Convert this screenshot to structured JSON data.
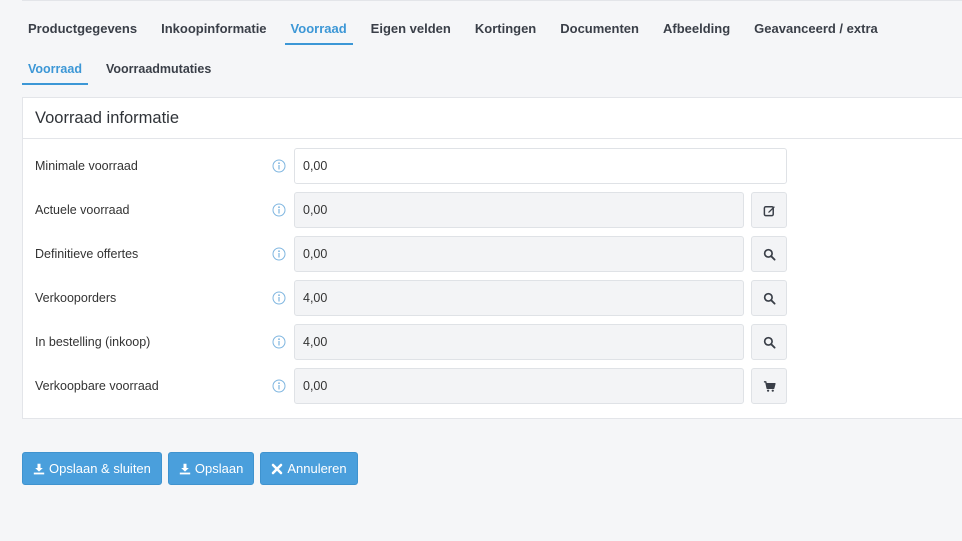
{
  "main_tabs": [
    {
      "label": "Productgegevens",
      "active": false
    },
    {
      "label": "Inkoopinformatie",
      "active": false
    },
    {
      "label": "Voorraad",
      "active": true
    },
    {
      "label": "Eigen velden",
      "active": false
    },
    {
      "label": "Kortingen",
      "active": false
    },
    {
      "label": "Documenten",
      "active": false
    },
    {
      "label": "Afbeelding",
      "active": false
    },
    {
      "label": "Geavanceerd / extra",
      "active": false
    }
  ],
  "sub_tabs": [
    {
      "label": "Voorraad",
      "active": true
    },
    {
      "label": "Voorraadmutaties",
      "active": false
    }
  ],
  "panel": {
    "title": "Voorraad informatie",
    "rows": [
      {
        "label": "Minimale voorraad",
        "value": "0,00",
        "editable": true,
        "action_icon": null
      },
      {
        "label": "Actuele voorraad",
        "value": "0,00",
        "editable": false,
        "action_icon": "edit-icon"
      },
      {
        "label": "Definitieve offertes",
        "value": "0,00",
        "editable": false,
        "action_icon": "search-icon"
      },
      {
        "label": "Verkooporders",
        "value": "4,00",
        "editable": false,
        "action_icon": "search-icon"
      },
      {
        "label": "In bestelling (inkoop)",
        "value": "4,00",
        "editable": false,
        "action_icon": "search-icon"
      },
      {
        "label": "Verkoopbare voorraad",
        "value": "0,00",
        "editable": false,
        "action_icon": "cart-icon"
      }
    ]
  },
  "buttons": {
    "save_close": {
      "label": "Opslaan & sluiten",
      "icon": "download-icon"
    },
    "save": {
      "label": "Opslaan",
      "icon": "download-icon"
    },
    "cancel": {
      "label": "Annuleren",
      "icon": "close-icon"
    }
  },
  "colors": {
    "accent": "#3c97d6",
    "button": "#4a9fdc",
    "background": "#f5f6f8",
    "readonly_field": "#f3f4f6"
  }
}
